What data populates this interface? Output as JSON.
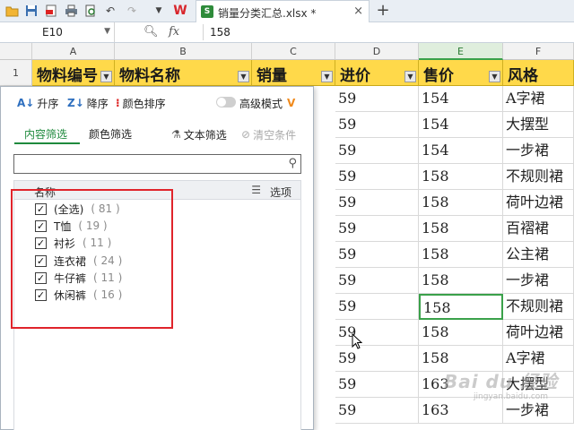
{
  "toolbar": {
    "tab_title": "销量分类汇总.xlsx *",
    "tab_close": "×",
    "new_tab": "+",
    "app_logo": "W"
  },
  "formula_bar": {
    "cell_ref": "E10",
    "fx_label": "fx",
    "value": "158"
  },
  "columns": [
    {
      "letter": "A"
    },
    {
      "letter": "B"
    },
    {
      "letter": "C"
    },
    {
      "letter": "D"
    },
    {
      "letter": "E",
      "selected": true
    },
    {
      "letter": "F"
    }
  ],
  "header_row": {
    "row_number": "1",
    "cells": [
      "物料编号",
      "物料名称",
      "销量",
      "进价",
      "售价",
      "风格"
    ]
  },
  "rows": [
    {
      "purchase": "59",
      "sale": "154",
      "style": "A字裙"
    },
    {
      "purchase": "59",
      "sale": "154",
      "style": "大摆型"
    },
    {
      "purchase": "59",
      "sale": "154",
      "style": "一步裙"
    },
    {
      "purchase": "59",
      "sale": "158",
      "style": "不规则裙"
    },
    {
      "purchase": "59",
      "sale": "158",
      "style": "荷叶边裙"
    },
    {
      "purchase": "59",
      "sale": "158",
      "style": "百褶裙"
    },
    {
      "purchase": "59",
      "sale": "158",
      "style": "公主裙"
    },
    {
      "purchase": "59",
      "sale": "158",
      "style": "一步裙"
    },
    {
      "purchase": "59",
      "sale": "158",
      "style": "不规则裙",
      "active": true
    },
    {
      "purchase": "59",
      "sale": "158",
      "style": "荷叶边裙"
    },
    {
      "purchase": "59",
      "sale": "158",
      "style": "A字裙"
    },
    {
      "purchase": "59",
      "sale": "163",
      "style": "大摆型"
    },
    {
      "purchase": "59",
      "sale": "163",
      "style": "一步裙"
    }
  ],
  "filter_panel": {
    "sort_asc": "升序",
    "sort_desc": "降序",
    "color_sort": "颜色排序",
    "advanced_mode": "高级模式",
    "tabs": [
      "内容筛选",
      "颜色筛选"
    ],
    "text_filter": "文本筛选",
    "clear_condition": "清空条件",
    "search_placeholder": "",
    "list_header": "名称",
    "options_label": "选项",
    "items": [
      {
        "label": "(全选)",
        "count": "( 81 )",
        "checked": true
      },
      {
        "label": "T恤",
        "count": "( 19 )",
        "checked": true
      },
      {
        "label": "衬衫",
        "count": "( 11 )",
        "checked": true
      },
      {
        "label": "连衣裙",
        "count": "( 24 )",
        "checked": true
      },
      {
        "label": "牛仔裤",
        "count": "( 11 )",
        "checked": true
      },
      {
        "label": "休闲裤",
        "count": "( 16 )",
        "checked": true
      }
    ]
  },
  "watermark": {
    "text": "Bai du 经验",
    "sub": "jingyan.baidu.com"
  },
  "colors": {
    "header_fill": "#ffd94a",
    "accent_green": "#1f8a3d",
    "highlight_red": "#e0242b"
  }
}
